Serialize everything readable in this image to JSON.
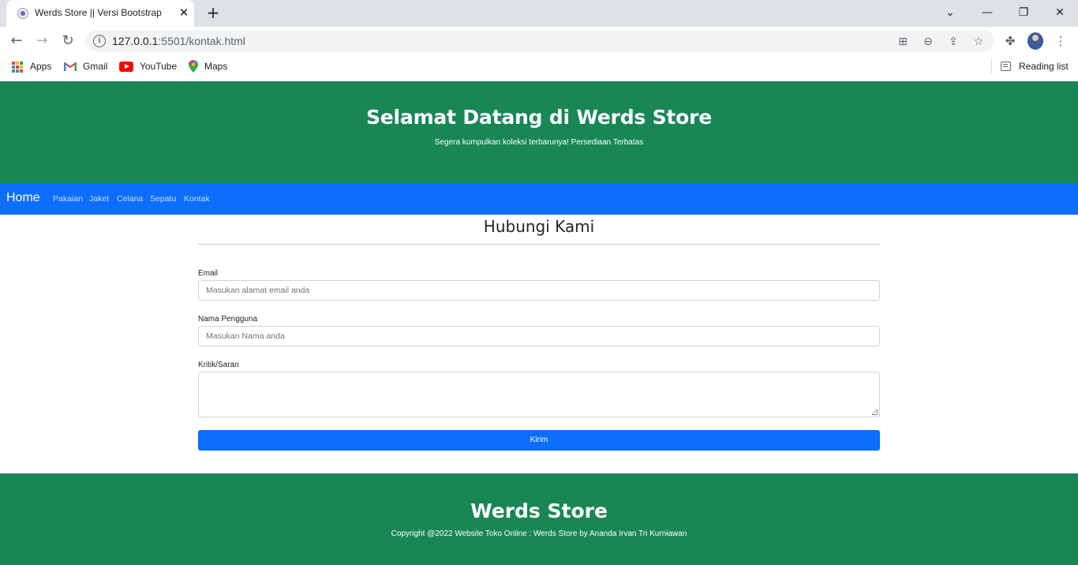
{
  "browser": {
    "tab_title": "Werds Store || Versi Bootstrap",
    "tab_close": "✕",
    "new_tab": "+",
    "url_host": "127.0.0.1",
    "url_rest": ":5501/kontak.html",
    "bookmarks": [
      {
        "label": "Apps",
        "icon": "apps-grid-icon"
      },
      {
        "label": "Gmail",
        "icon": "gmail-icon"
      },
      {
        "label": "YouTube",
        "icon": "youtube-icon"
      },
      {
        "label": "Maps",
        "icon": "maps-icon"
      }
    ],
    "reading_list": "Reading list"
  },
  "hero": {
    "title": "Selamat Datang di Werds Store",
    "subtitle": "Segera kumpulkan koleksi terbarunya! Persediaan Terbatas"
  },
  "nav": {
    "brand": "Home",
    "links": [
      "Pakaian",
      "Jaket",
      "Celana",
      "Sepatu",
      "Kontak"
    ]
  },
  "contact": {
    "heading": "Hubungi Kami",
    "email_label": "Email",
    "email_placeholder": "Masukan alamat email anda",
    "username_label": "Nama Pengguna",
    "username_placeholder": "Masukan Nama anda",
    "feedback_label": "Kritik/Saran",
    "submit_label": "Kirim"
  },
  "footer": {
    "title": "Werds Store",
    "copyright": "Copyright @2022 Website Toko Online : Werds Store by Ananda Irvan Tri Kurniawan"
  },
  "colors": {
    "green": "#198754",
    "blue": "#0d6efd"
  }
}
